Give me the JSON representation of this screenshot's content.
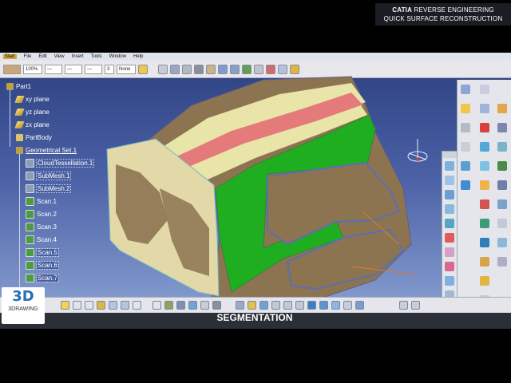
{
  "menu": {
    "items": [
      "Start",
      "File",
      "Edit",
      "View",
      "Insert",
      "Tools",
      "Window",
      "Help"
    ]
  },
  "toolbar": {
    "zoom_value": "100%",
    "layer_value": "3",
    "filter_value": "None"
  },
  "banner": {
    "brand": "CATIA",
    "line1_rest": "REVERSE ENGINEERING",
    "line2": "QUICK SURFACE RECONSTRUCTION"
  },
  "tree": {
    "items": [
      {
        "label": "Part1",
        "icon": "part-icon"
      },
      {
        "label": "xy plane",
        "icon": "plane-icon"
      },
      {
        "label": "yz plane",
        "icon": "plane-icon"
      },
      {
        "label": "zx plane",
        "icon": "plane-icon"
      },
      {
        "label": "PartBody",
        "icon": "body-icon"
      },
      {
        "label": "Geometrical Set.1",
        "icon": "geometrical-set-icon"
      },
      {
        "label": "CloudTessellation.1",
        "icon": "mesh-icon"
      },
      {
        "label": "SubMesh.1",
        "icon": "mesh-icon"
      },
      {
        "label": "SubMesh.2",
        "icon": "mesh-icon"
      },
      {
        "label": "Scan.1",
        "icon": "scan-icon"
      },
      {
        "label": "Scan.2",
        "icon": "scan-icon"
      },
      {
        "label": "Scan.3",
        "icon": "scan-icon"
      },
      {
        "label": "Scan.4",
        "icon": "scan-icon"
      },
      {
        "label": "Scan.5",
        "icon": "scan-icon"
      },
      {
        "label": "Scan.6",
        "icon": "scan-icon"
      },
      {
        "label": "Scan.7",
        "icon": "scan-icon"
      }
    ]
  },
  "logo": {
    "mark": "3D",
    "text": "3DRAWING"
  },
  "caption": "SEGMENTATION",
  "colors": {
    "background_top": "#2b3f7e",
    "segment_green": "#1fae1f",
    "segment_pink": "#e47a7a",
    "segment_yellow": "#e9e4a8",
    "segment_brown": "#8c7450"
  }
}
